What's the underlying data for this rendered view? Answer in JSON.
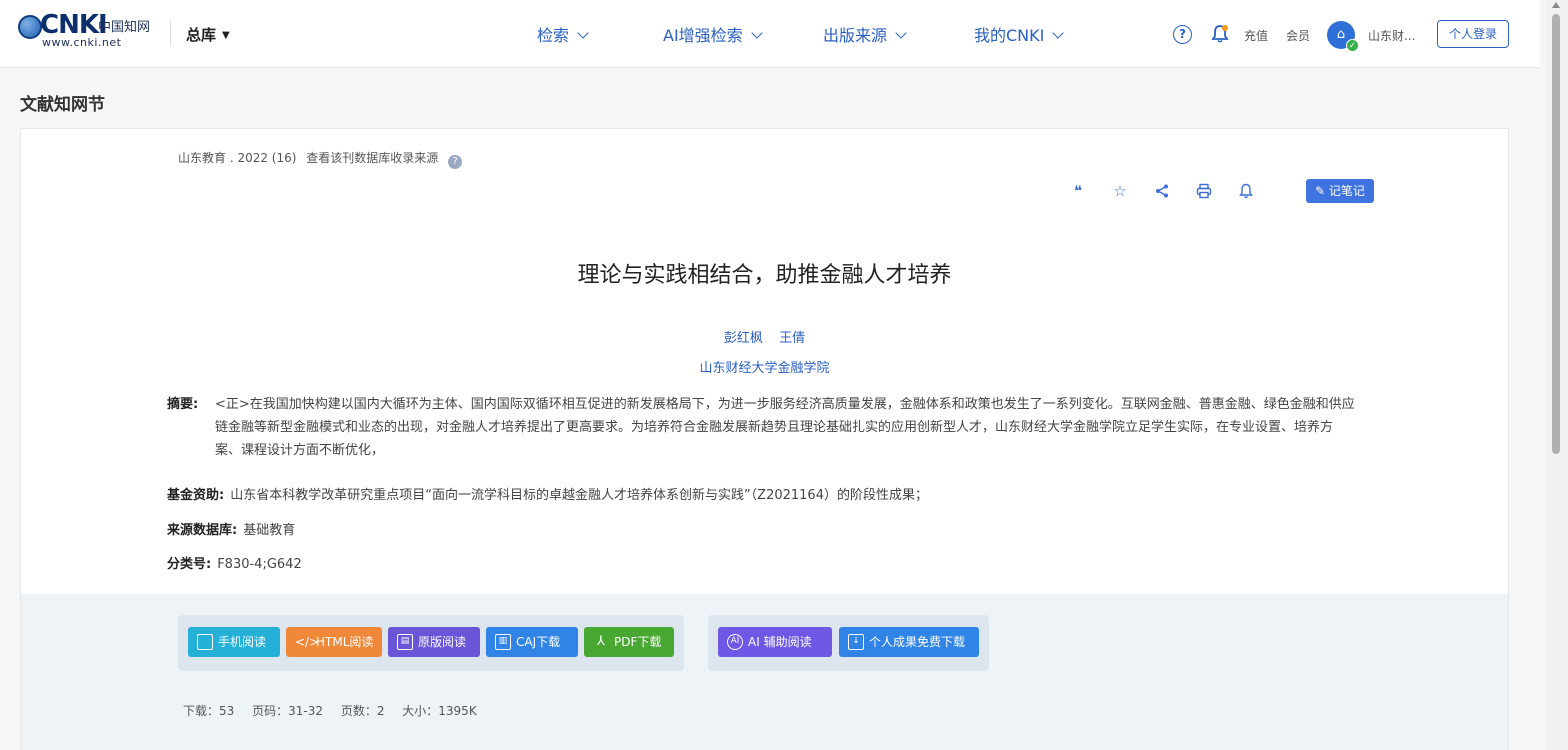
{
  "header": {
    "logo_text": "CNKI",
    "logo_cn": "中国知网",
    "logo_url": "www.cnki.net",
    "library": "总库",
    "nav": [
      "检索",
      "AI增强检索",
      "出版来源",
      "我的CNKI"
    ],
    "recharge": "充值",
    "member": "会员",
    "institution": "山东财...",
    "login": "个人登录"
  },
  "section_title": "文献知网节",
  "article": {
    "source": "山东教育 . 2022 (16)",
    "source_link": "查看该刊数据库收录来源",
    "note_button": "记笔记",
    "title": "理论与实践相结合，助推金融人才培养",
    "authors": [
      "彭红枫",
      "王倩"
    ],
    "affiliation": "山东财经大学金融学院",
    "abstract_label": "摘要:",
    "abstract_text": "<正>在我国加快构建以国内大循环为主体、国内国际双循环相互促进的新发展格局下，为进一步服务经济高质量发展，金融体系和政策也发生了一系列变化。互联网金融、普惠金融、绿色金融和供应链金融等新型金融模式和业态的出现，对金融人才培养提出了更高要求。为培养符合金融发展新趋势且理论基础扎实的应用创新型人才，山东财经大学金融学院立足学生实际，在专业设置、培养方案、课程设计方面不断优化，",
    "fund_label": "基金资助:",
    "fund_text": "山东省本科教学改革研究重点项目“面向一流学科目标的卓越金融人才培养体系创新与实践”（Z2021164）的阶段性成果；",
    "db_label": "来源数据库:",
    "db_text": "基础教育",
    "class_label": "分类号:",
    "class_text": "F830-4;G642"
  },
  "read_buttons": [
    {
      "label": "手机阅读",
      "color": "#25b0d8",
      "icon": "phone-icon"
    },
    {
      "label": "HTML阅读",
      "color": "#f0883a",
      "icon": "code-icon"
    },
    {
      "label": "原版阅读",
      "color": "#6a55d8",
      "icon": "book-icon"
    },
    {
      "label": "CAJ下载",
      "color": "#2f84e6",
      "icon": "caj-icon"
    },
    {
      "label": "PDF下载",
      "color": "#49a832",
      "icon": "pdf-icon"
    }
  ],
  "ai_buttons": [
    {
      "label": "AI 辅助阅读",
      "color": "#6f58e6",
      "icon": "ai-icon"
    },
    {
      "label": "个人成果免费下载",
      "color": "#2f84e6",
      "icon": "download-icon"
    }
  ],
  "stats": {
    "downloads": "下载：53",
    "pages": "页码：31-32",
    "page_count": "页数：2",
    "size": "大小：1395K"
  }
}
